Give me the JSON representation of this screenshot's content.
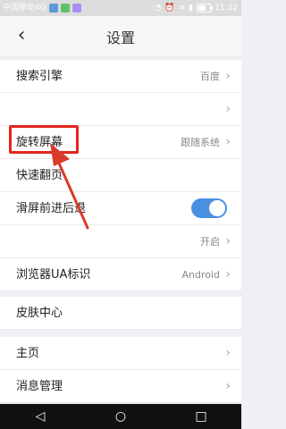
{
  "status_bar": {
    "carrier": "中国移动4G",
    "time": "11:22"
  },
  "header": {
    "title": "设置",
    "back_icon": "back-icon"
  },
  "rows": [
    {
      "label": "搜索引擎",
      "value": "百度"
    },
    {
      "label": "",
      "value": ""
    },
    {
      "label": "旋转屏幕",
      "value": "跟随系统"
    },
    {
      "label": "快速翻页",
      "value": ""
    },
    {
      "label": "滑屏前进后退",
      "value": ""
    },
    {
      "label": "",
      "value": "开启"
    },
    {
      "label": "浏览器UA标识",
      "value": "Android"
    },
    {
      "label": "皮肤中心",
      "value": ""
    },
    {
      "label": "主页",
      "value": ""
    },
    {
      "label": "消息管理",
      "value": ""
    }
  ],
  "toggle": {
    "state": "on"
  },
  "colors": {
    "accent": "#4a90e2",
    "highlight_red": "#e1261c",
    "arrow_red": "#d93b2b"
  },
  "nav_bar": {
    "back": "◁",
    "home": "○",
    "recents": "□"
  }
}
